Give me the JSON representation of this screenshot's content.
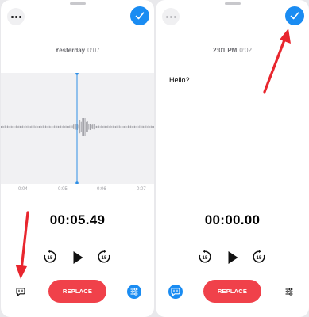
{
  "left_screen": {
    "date_label": "Yesterday",
    "duration": "0:07",
    "timeline_ticks": [
      "0:04",
      "0:05",
      "0:06",
      "0:07"
    ],
    "elapsed_time": "00:05.49",
    "replace_label": "REPLACE",
    "icons": {
      "more": "more-icon",
      "done": "checkmark-icon",
      "skip_back": "skip-back-15-icon",
      "play": "play-icon",
      "skip_forward": "skip-forward-15-icon",
      "transcript": "transcript-bubble-icon",
      "options": "sliders-icon"
    }
  },
  "right_screen": {
    "date_label": "2:01 PM",
    "duration": "0:02",
    "transcript_text": "Hello?",
    "elapsed_time": "00:00.00",
    "replace_label": "REPLACE",
    "icons": {
      "more": "more-icon",
      "done": "checkmark-icon",
      "skip_back": "skip-back-15-icon",
      "play": "play-icon",
      "skip_forward": "skip-forward-15-icon",
      "transcript": "transcript-bubble-icon",
      "options": "sliders-icon"
    }
  },
  "colors": {
    "accent_blue": "#1a8cf2",
    "record_red": "#f0414a",
    "annotation_arrow": "#e8262e",
    "playhead": "#2f8fe6"
  }
}
